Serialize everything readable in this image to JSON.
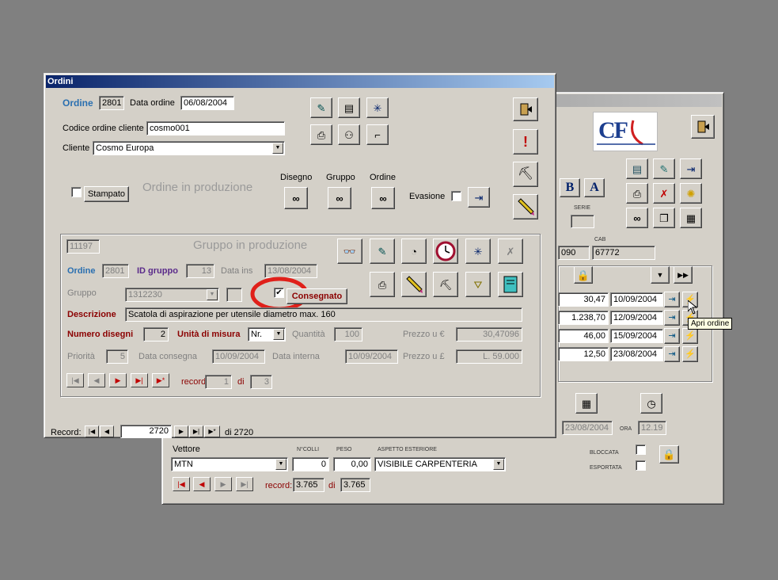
{
  "back_window": {
    "logo_text": "CF",
    "labels": {
      "serie": "SERIE",
      "cab": "CAB",
      "ora": "ORA"
    },
    "fields": {
      "abi_partial": "090",
      "cab": "67772",
      "date_bottom": "23/08/2004",
      "ora_value": "12.19"
    },
    "rows": [
      {
        "amount": "30,47",
        "date": "10/09/2004"
      },
      {
        "amount": "1.238,70",
        "date": "12/09/2004"
      },
      {
        "amount": "46,00",
        "date": "15/09/2004"
      },
      {
        "amount": "12,50",
        "date": "23/08/2004"
      }
    ],
    "tooltip": "Apri ordine",
    "shipping": {
      "vettore_label": "Vettore",
      "vettore_value": "MTN",
      "colli_label": "N°COLLI",
      "colli_value": "0",
      "peso_label": "PESO",
      "peso_value": "0,00",
      "aspetto_label": "ASPETTO ESTERIORE",
      "aspetto_value": "VISIBILE CARPENTERIA",
      "bloccata_label": "BLOCCATA",
      "esportata_label": "ESPORTATA",
      "record_label": "record:",
      "record_value": "3.765",
      "di_label": "di",
      "di_value": "3.765"
    },
    "bold_b": "B",
    "bold_a": "A"
  },
  "ordini": {
    "title": "Ordini",
    "ordine_label": "Ordine",
    "ordine_value": "2801",
    "data_ordine_label": "Data ordine",
    "data_ordine_value": "06/08/2004",
    "codice_label": "Codice ordine cliente",
    "codice_value": "cosmo001",
    "cliente_label": "Cliente",
    "cliente_value": "Cosmo Europa",
    "stampato_label": "Stampato",
    "in_produzione_label": "Ordine in produzione",
    "disegno_label": "Disegno",
    "gruppo_label": "Gruppo",
    "ordine_col_label": "Ordine",
    "evasione_label": "Evasione",
    "record_label": "Record:",
    "record_value": "2720",
    "record_of": "di 2720"
  },
  "gruppo": {
    "id_box": "11197",
    "title": "Gruppo in produzione",
    "ordine_label": "Ordine",
    "ordine_value": "2801",
    "id_gruppo_label": "ID gruppo",
    "id_gruppo_value": "13",
    "data_ins_label": "Data ins",
    "data_ins_value": "13/08/2004",
    "gruppo_label": "Gruppo",
    "gruppo_value": "1312230",
    "consegnato_label": "Consegnato",
    "consegnato_checked": "✔",
    "descrizione_label": "Descrizione",
    "descrizione_value": "Scatola di aspirazione per utensile diametro max. 160",
    "num_disegni_label": "Numero disegni",
    "num_disegni_value": "2",
    "unita_label": "Unità di misura",
    "unita_value": "Nr.",
    "quantita_label": "Quantità",
    "quantita_value": "100",
    "prezzo_euro_label": "Prezzo u €",
    "prezzo_euro_value": "30,47096",
    "priorita_label": "Priorità",
    "priorita_value": "5",
    "data_consegna_label": "Data consegna",
    "data_consegna_value": "10/09/2004",
    "data_interna_label": "Data interna",
    "data_interna_value": "10/09/2004",
    "prezzo_lire_label": "Prezzo u £",
    "prezzo_lire_value": "L. 59.000",
    "record_label": "record:",
    "record_value": "1",
    "di_label": "di",
    "di_value": "3"
  },
  "colors": {
    "highlight_circle": "#e0201a",
    "title_active": "#0a246a",
    "label_blue": "#2a6fb0"
  }
}
